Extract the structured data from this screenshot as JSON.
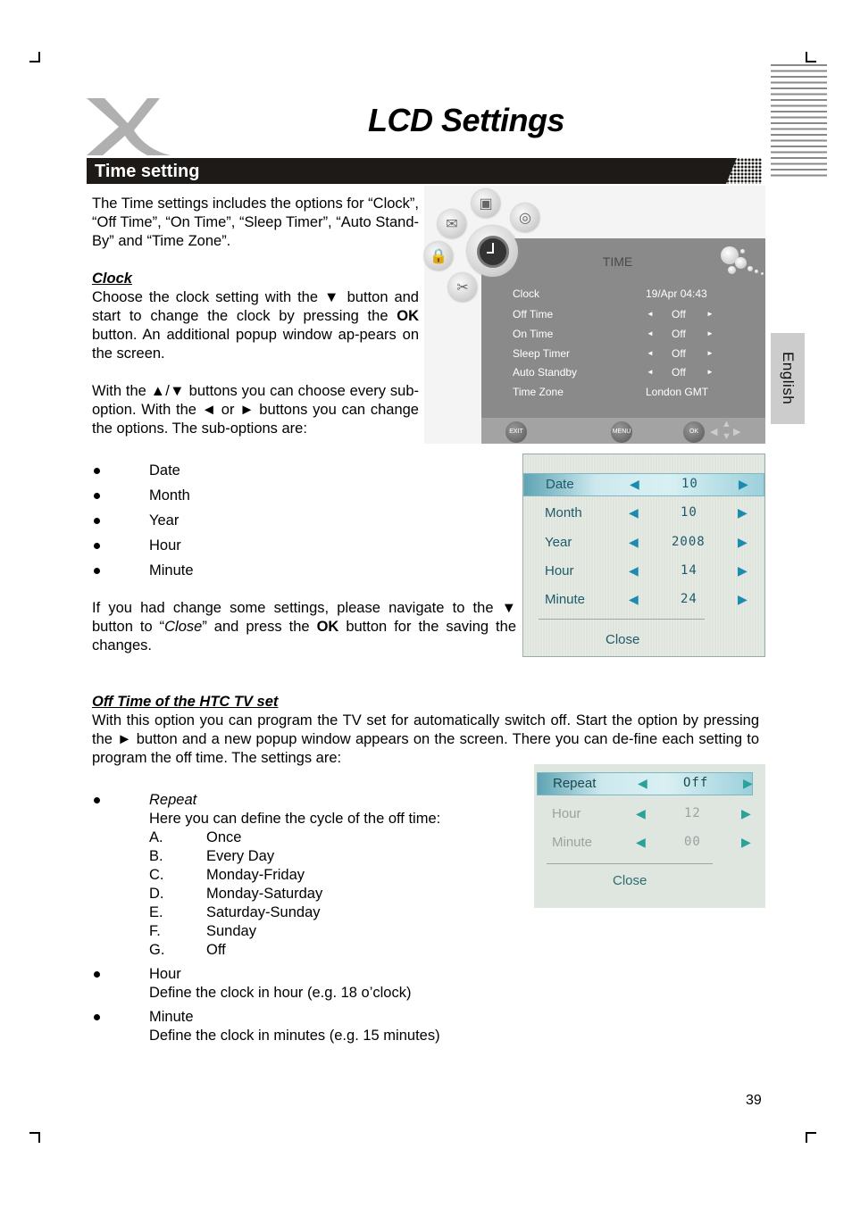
{
  "header": {
    "logo": "x-logo-icon",
    "title": "LCD Settings",
    "section": "Time setting",
    "language_tab": "English"
  },
  "intro": {
    "text": "The Time settings includes the options for “Clock”, “Off Time”, “On Time”, “Sleep Timer”, “Auto Stand-By” and “Time Zone”."
  },
  "clock_section": {
    "heading": "Clock",
    "p1_a": "Choose the clock setting with the ▼ button and start to change the clock by pressing the ",
    "p1_bold": "OK",
    "p1_b": " button. An additional popup window ap-pears on the screen.",
    "p2": "With the ▲/▼ buttons you can choose every sub-option. With the ◄ or ► buttons you can change the options. The sub-options are:",
    "suboptions": [
      "Date",
      "Month",
      "Year",
      "Hour",
      "Minute"
    ],
    "p3_a": "If you had change some settings, please navigate to the ▼ button to “",
    "p3_italic": "Close",
    "p3_b": "” and press the ",
    "p3_bold": "OK",
    "p3_c": " button for the saving the changes."
  },
  "off_time_section": {
    "heading": "Off Time of the HTC TV set",
    "p1": "With this option you can program the TV set for automatically switch off. Start the option by pressing the ► button and a new popup window appears on the screen. There you can de-fine each setting to program the off time. The settings are:",
    "repeat_label": "Repeat",
    "repeat_desc": "Here you can define the cycle of the off time:",
    "repeat_options": [
      {
        "letter": "A.",
        "text": "Once"
      },
      {
        "letter": "B.",
        "text": "Every Day"
      },
      {
        "letter": "C.",
        "text": "Monday-Friday"
      },
      {
        "letter": "D.",
        "text": "Monday-Saturday"
      },
      {
        "letter": "E.",
        "text": "Saturday-Sunday"
      },
      {
        "letter": "F.",
        "text": "Sunday"
      },
      {
        "letter": "G.",
        "text": "Off"
      }
    ],
    "hour_label": "Hour",
    "hour_desc": "Define the clock in hour (e.g. 18 o’clock)",
    "minute_label": "Minute",
    "minute_desc": "Define the clock in minutes (e.g. 15 minutes)"
  },
  "tv_menu": {
    "title": "TIME",
    "rows": [
      {
        "label": "Clock",
        "value": "19/Apr 04:43",
        "arrows": false
      },
      {
        "label": "Off Time",
        "value": "Off",
        "arrows": true
      },
      {
        "label": "On Time",
        "value": "Off",
        "arrows": true
      },
      {
        "label": "Sleep Timer",
        "value": "Off",
        "arrows": true
      },
      {
        "label": "Auto Standby",
        "value": "Off",
        "arrows": true
      },
      {
        "label": "Time Zone",
        "value": "London GMT",
        "arrows": false
      }
    ],
    "buttons": {
      "exit": "EXIT",
      "menu": "MENU",
      "ok": "OK"
    },
    "arrow_left": "◄",
    "arrow_right": "►"
  },
  "clock_popup": {
    "rows": [
      {
        "label": "Date",
        "value": "10"
      },
      {
        "label": "Month",
        "value": "10"
      },
      {
        "label": "Year",
        "value": "2008"
      },
      {
        "label": "Hour",
        "value": "14"
      },
      {
        "label": "Minute",
        "value": "24"
      }
    ],
    "close": "Close",
    "arrow_left": "◀",
    "arrow_right": "▶"
  },
  "offtime_popup": {
    "rows": [
      {
        "label": "Repeat",
        "value": "Off"
      },
      {
        "label": "Hour",
        "value": "12"
      },
      {
        "label": "Minute",
        "value": "00"
      }
    ],
    "close": "Close",
    "arrow_left": "◀",
    "arrow_right": "▶"
  },
  "page_number": "39"
}
